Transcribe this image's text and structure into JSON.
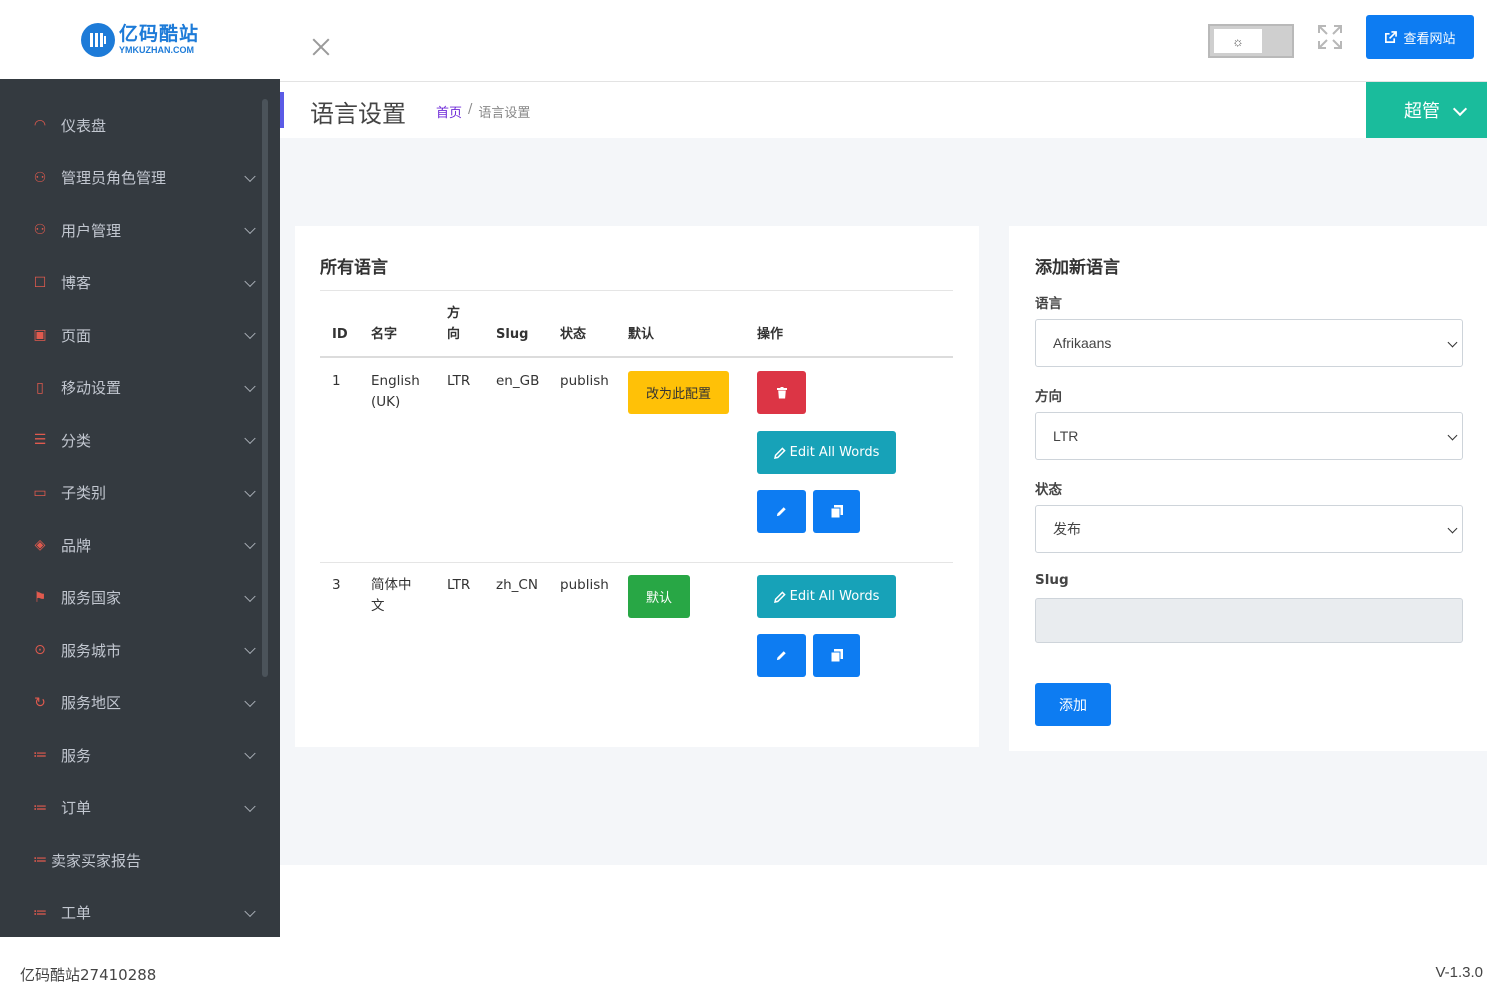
{
  "brand": {
    "name_cn": "亿码酷站",
    "name_en": "YMKUZHAN.COM",
    "color": "#1d7bd8"
  },
  "sidebar": {
    "items": [
      {
        "label": "仪表盘",
        "icon": "dashboard-icon",
        "expandable": false
      },
      {
        "label": "管理员角色管理",
        "icon": "user-icon",
        "expandable": true
      },
      {
        "label": "用户管理",
        "icon": "user-icon",
        "expandable": true
      },
      {
        "label": "博客",
        "icon": "comment-icon",
        "expandable": true
      },
      {
        "label": "页面",
        "icon": "page-icon",
        "expandable": true
      },
      {
        "label": "移动设置",
        "icon": "mobile-icon",
        "expandable": true
      },
      {
        "label": "分类",
        "icon": "category-icon",
        "expandable": true
      },
      {
        "label": "子类别",
        "icon": "wallet-icon",
        "expandable": true
      },
      {
        "label": "品牌",
        "icon": "layers-icon",
        "expandable": true
      },
      {
        "label": "服务国家",
        "icon": "flag-icon",
        "expandable": true
      },
      {
        "label": "服务城市",
        "icon": "circle-arrow-icon",
        "expandable": true
      },
      {
        "label": "服务地区",
        "icon": "refresh-icon",
        "expandable": true
      },
      {
        "label": "服务",
        "icon": "list-icon",
        "expandable": true
      },
      {
        "label": "订单",
        "icon": "list-icon",
        "expandable": true
      },
      {
        "label": "卖家买家报告",
        "icon": "list-icon",
        "expandable": false
      },
      {
        "label": "工单",
        "icon": "list-icon",
        "expandable": true
      }
    ],
    "icon_color": "#e05a4e",
    "bg_color": "#343a40"
  },
  "topbar": {
    "theme_toggle_icon": "sun-icon",
    "view_site_label": "查看网站",
    "view_site_icon": "external-link-icon"
  },
  "header": {
    "title": "语言设置",
    "breadcrumb_home": "首页",
    "breadcrumb_sep": "/",
    "breadcrumb_current": "语言设置",
    "admin_label": "超管",
    "admin_color": "#1abc9c"
  },
  "languages_card": {
    "title": "所有语言",
    "columns": {
      "id": "ID",
      "name": "名字",
      "direction_l1": "方",
      "direction_l2": "向",
      "slug": "Slug",
      "status": "状态",
      "default": "默认",
      "actions": "操作"
    },
    "rows": [
      {
        "id": "1",
        "name_l1": "English",
        "name_l2": "(UK)",
        "direction": "LTR",
        "slug": "en_GB",
        "status": "publish",
        "default_button": "改为此配置",
        "edit_words": "Edit All Words"
      },
      {
        "id": "3",
        "name_l1": "简体中",
        "name_l2": "文",
        "direction": "LTR",
        "slug": "zh_CN",
        "status": "publish",
        "default_button": "默认",
        "edit_words": "Edit All Words"
      }
    ]
  },
  "add_card": {
    "title": "添加新语言",
    "language_label": "语言",
    "language_value": "Afrikaans",
    "direction_label": "方向",
    "direction_value": "LTR",
    "status_label": "状态",
    "status_value": "发布",
    "slug_label": "Slug",
    "slug_value": "",
    "submit_label": "添加"
  },
  "footer": {
    "left": "亿码酷站27410288",
    "version": "V-1.3.0"
  }
}
